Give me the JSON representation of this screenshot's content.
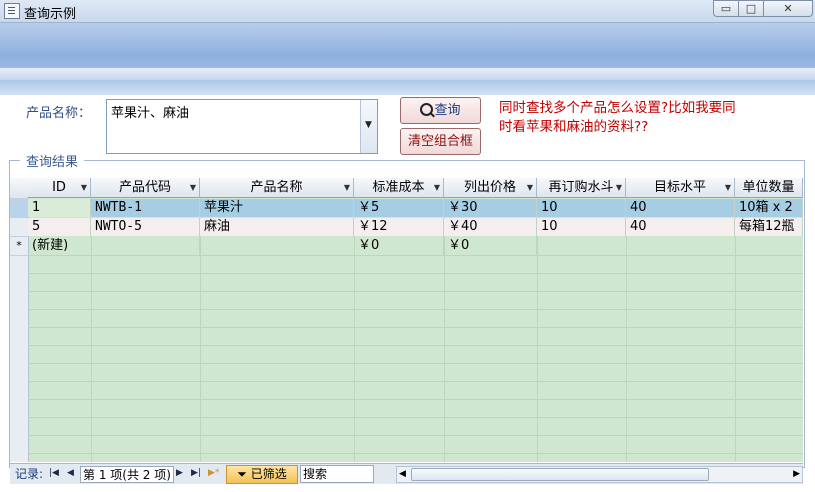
{
  "window": {
    "title": "查询示例",
    "min_glyph": "▭",
    "max_glyph": "□",
    "close_glyph": "✕"
  },
  "form": {
    "product_label": "产品名称：",
    "product_value": "苹果汁、麻油",
    "query_button": "查询",
    "clear_button": "清空组合框",
    "note_line1": "同时查找多个产品怎么设置?比如我要同",
    "note_line2": "时看苹果和麻油的资料??",
    "results_label": "查询结果"
  },
  "table": {
    "columns": [
      "ID",
      "产品代码",
      "产品名称",
      "标准成本",
      "列出价格",
      "再订购水斗",
      "目标水平",
      "单位数量"
    ],
    "rows": [
      [
        "1",
        "NWTB-1",
        "苹果汁",
        "￥5",
        "￥30",
        "10",
        "40",
        "10箱 x 2"
      ],
      [
        "5",
        "NWTO-5",
        "麻油",
        "￥12",
        "￥40",
        "10",
        "40",
        "每箱12瓶"
      ]
    ],
    "new_row": [
      "(新建)",
      "",
      "",
      "￥0",
      "￥0",
      "",
      "",
      ""
    ],
    "new_row_marker": "*"
  },
  "status": {
    "record_label": "记录:",
    "record_position": "第 1 项(共 2 项)",
    "filter_badge": "已筛选",
    "search_placeholder": "搜索"
  }
}
